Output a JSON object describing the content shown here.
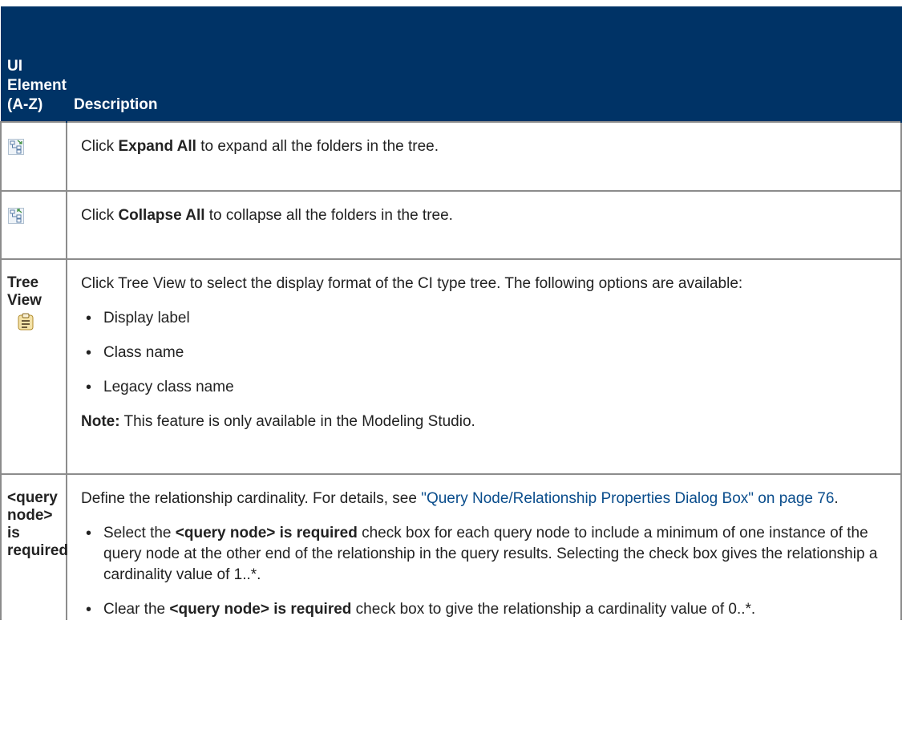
{
  "header": {
    "col1": "UI\nElement\n(A-Z)",
    "col2": "Description"
  },
  "rows": [
    {
      "icon": "expand-all-icon",
      "pre": "Click ",
      "bold": "Expand All",
      "post": " to expand all the folders in the tree."
    },
    {
      "icon": "collapse-all-icon",
      "pre": "Click ",
      "bold": "Collapse All",
      "post": " to collapse all the folders in the tree."
    },
    {
      "label": "Tree View",
      "icon": "tree-view-icon",
      "intro": "Click Tree View to select the display format of the CI type tree. The following options are available:",
      "options": [
        "Display label",
        "Class name",
        "Legacy class name"
      ],
      "note_label": "Note:",
      "note_text": " This feature is only available in the Modeling Studio."
    },
    {
      "label": "<query\nnode> is\nrequired",
      "intro_pre": "Define the relationship cardinality. For details, see ",
      "link": "\"Query Node/Relationship Properties Dialog Box\" on page 76",
      "intro_post": ".",
      "bullet1_pre": "Select the ",
      "bullet1_bold": "<query node> is required",
      "bullet1_post": " check box for each query node to include a minimum of one instance of the query node at the other end of the relationship in the query results. Selecting the check box gives the relationship a cardinality value of 1..*.",
      "bullet2_pre": "Clear the ",
      "bullet2_bold": "<query node> is required",
      "bullet2_post": " check box to give the relationship a cardinality value of 0..*."
    }
  ],
  "colors": {
    "header_bg": "#003366",
    "header_text": "#ffffff",
    "link": "#0a4d8c",
    "border": "#8c8c8c"
  }
}
